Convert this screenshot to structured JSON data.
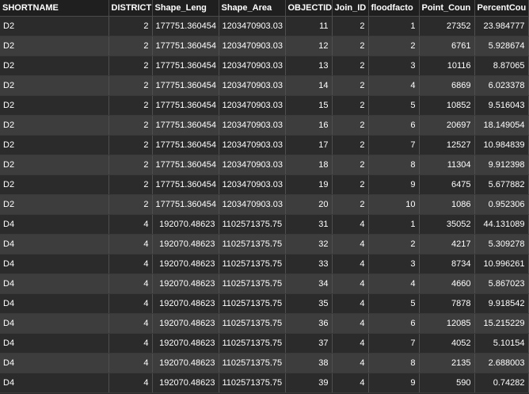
{
  "table": {
    "columns": [
      "SHORTNAME",
      "DISTRICT",
      "Shape_Leng",
      "Shape_Area",
      "OBJECTID",
      "Join_ID",
      "floodfacto",
      "Point_Coun",
      "PercentCou"
    ],
    "rows": [
      [
        "D2",
        "2",
        "177751.360454",
        "1203470903.03",
        "11",
        "2",
        "1",
        "27352",
        "23.984777"
      ],
      [
        "D2",
        "2",
        "177751.360454",
        "1203470903.03",
        "12",
        "2",
        "2",
        "6761",
        "5.928674"
      ],
      [
        "D2",
        "2",
        "177751.360454",
        "1203470903.03",
        "13",
        "2",
        "3",
        "10116",
        "8.87065"
      ],
      [
        "D2",
        "2",
        "177751.360454",
        "1203470903.03",
        "14",
        "2",
        "4",
        "6869",
        "6.023378"
      ],
      [
        "D2",
        "2",
        "177751.360454",
        "1203470903.03",
        "15",
        "2",
        "5",
        "10852",
        "9.516043"
      ],
      [
        "D2",
        "2",
        "177751.360454",
        "1203470903.03",
        "16",
        "2",
        "6",
        "20697",
        "18.149054"
      ],
      [
        "D2",
        "2",
        "177751.360454",
        "1203470903.03",
        "17",
        "2",
        "7",
        "12527",
        "10.984839"
      ],
      [
        "D2",
        "2",
        "177751.360454",
        "1203470903.03",
        "18",
        "2",
        "8",
        "11304",
        "9.912398"
      ],
      [
        "D2",
        "2",
        "177751.360454",
        "1203470903.03",
        "19",
        "2",
        "9",
        "6475",
        "5.677882"
      ],
      [
        "D2",
        "2",
        "177751.360454",
        "1203470903.03",
        "20",
        "2",
        "10",
        "1086",
        "0.952306"
      ],
      [
        "D4",
        "4",
        "192070.48623",
        "1102571375.75",
        "31",
        "4",
        "1",
        "35052",
        "44.131089"
      ],
      [
        "D4",
        "4",
        "192070.48623",
        "1102571375.75",
        "32",
        "4",
        "2",
        "4217",
        "5.309278"
      ],
      [
        "D4",
        "4",
        "192070.48623",
        "1102571375.75",
        "33",
        "4",
        "3",
        "8734",
        "10.996261"
      ],
      [
        "D4",
        "4",
        "192070.48623",
        "1102571375.75",
        "34",
        "4",
        "4",
        "4660",
        "5.867023"
      ],
      [
        "D4",
        "4",
        "192070.48623",
        "1102571375.75",
        "35",
        "4",
        "5",
        "7878",
        "9.918542"
      ],
      [
        "D4",
        "4",
        "192070.48623",
        "1102571375.75",
        "36",
        "4",
        "6",
        "12085",
        "15.215229"
      ],
      [
        "D4",
        "4",
        "192070.48623",
        "1102571375.75",
        "37",
        "4",
        "7",
        "4052",
        "5.10154"
      ],
      [
        "D4",
        "4",
        "192070.48623",
        "1102571375.75",
        "38",
        "4",
        "8",
        "2135",
        "2.688003"
      ],
      [
        "D4",
        "4",
        "192070.48623",
        "1102571375.75",
        "39",
        "4",
        "9",
        "590",
        "0.74282"
      ]
    ]
  }
}
